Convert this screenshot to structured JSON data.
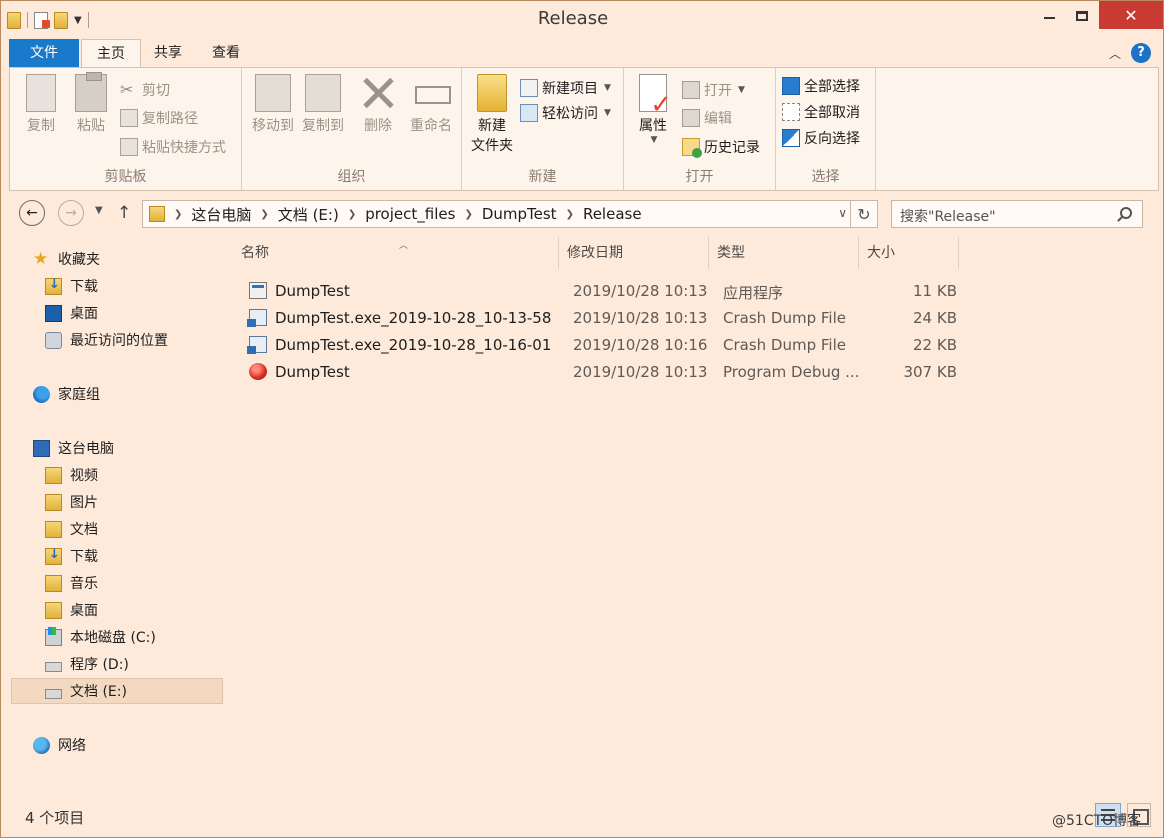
{
  "window": {
    "title": "Release",
    "close_glyph": "✕"
  },
  "ribbon_tabs": {
    "file": "文件",
    "home": "主页",
    "share": "共享",
    "view": "查看",
    "help": "?"
  },
  "ribbon": {
    "clipboard": {
      "label": "剪贴板",
      "copy": "复制",
      "paste": "粘贴",
      "cut": "剪切",
      "copy_path": "复制路径",
      "paste_shortcut": "粘贴快捷方式"
    },
    "organize": {
      "label": "组织",
      "move_to": "移动到",
      "copy_to": "复制到",
      "delete": "删除",
      "rename": "重命名"
    },
    "new": {
      "label": "新建",
      "new_folder_line1": "新建",
      "new_folder_line2": "文件夹",
      "new_item": "新建项目",
      "easy_access": "轻松访问"
    },
    "open": {
      "label": "打开",
      "properties": "属性",
      "open": "打开",
      "edit": "编辑",
      "history": "历史记录"
    },
    "select": {
      "label": "选择",
      "select_all": "全部选择",
      "select_none": "全部取消",
      "invert": "反向选择"
    }
  },
  "address": {
    "crumbs": [
      "这台电脑",
      "文档 (E:)",
      "project_files",
      "DumpTest",
      "Release"
    ],
    "search_placeholder": "搜索\"Release\""
  },
  "nav_pane": {
    "favorites": "收藏夹",
    "fav_items": [
      "下载",
      "桌面",
      "最近访问的位置"
    ],
    "homegroup": "家庭组",
    "this_pc": "这台电脑",
    "pc_items": [
      "视频",
      "图片",
      "文档",
      "下载",
      "音乐",
      "桌面",
      "本地磁盘 (C:)",
      "程序 (D:)",
      "文档 (E:)"
    ],
    "network": "网络"
  },
  "columns": {
    "name": "名称",
    "date": "修改日期",
    "type": "类型",
    "size": "大小"
  },
  "files": [
    {
      "name": "DumpTest",
      "date": "2019/10/28 10:13",
      "type": "应用程序",
      "size": "11 KB",
      "icon": "application-icon"
    },
    {
      "name": "DumpTest.exe_2019-10-28_10-13-58",
      "date": "2019/10/28 10:13",
      "type": "Crash Dump File",
      "size": "24 KB",
      "icon": "dump-file-icon"
    },
    {
      "name": "DumpTest.exe_2019-10-28_10-16-01",
      "date": "2019/10/28 10:16",
      "type": "Crash Dump File",
      "size": "22 KB",
      "icon": "dump-file-icon"
    },
    {
      "name": "DumpTest",
      "date": "2019/10/28 10:13",
      "type": "Program Debug ...",
      "size": "307 KB",
      "icon": "pdb-file-icon"
    }
  ],
  "status": {
    "item_count": "4 个项目"
  },
  "watermark": "@51CTO博客"
}
